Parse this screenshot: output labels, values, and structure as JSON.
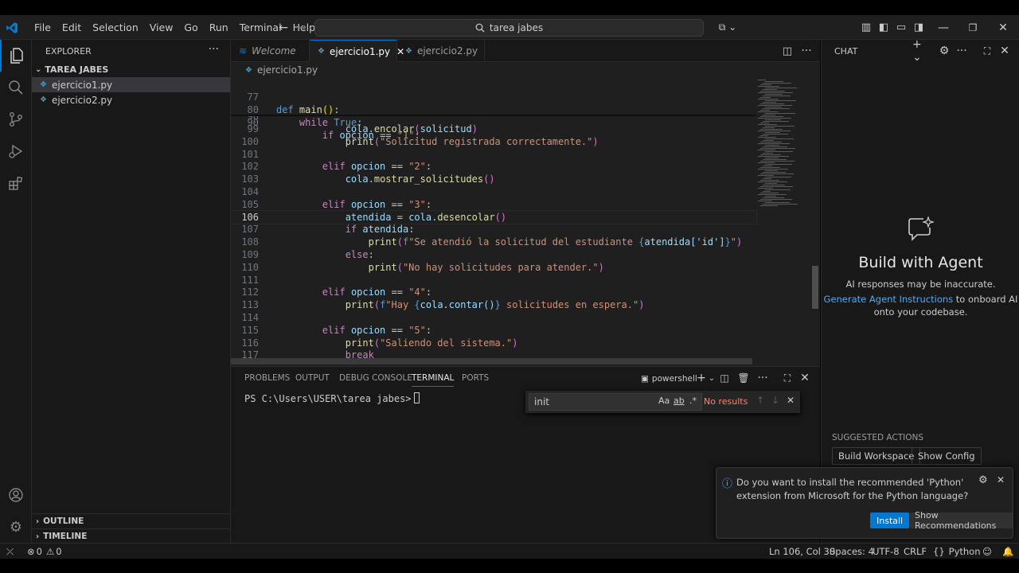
{
  "titlebar": {
    "menu": [
      "File",
      "Edit",
      "Selection",
      "View",
      "Go",
      "Run",
      "Terminal",
      "Help"
    ],
    "command_center": "tarea jabes",
    "icons": [
      "vscode-logo-icon",
      "back-arrow-icon",
      "forward-arrow-icon",
      "search-icon",
      "copilot-icon",
      "layout-icon",
      "minimize-icon",
      "restore-icon",
      "close-icon"
    ]
  },
  "activity_bar": [
    "files-icon",
    "search-icon",
    "source-control-icon",
    "run-debug-icon",
    "extensions-icon",
    "account-icon",
    "settings-gear-icon"
  ],
  "sidebar": {
    "title": "EXPLORER",
    "folder": "TAREA JABES",
    "files": [
      "ejercicio1.py",
      "ejercicio2.py"
    ],
    "selected_file": "ejercicio1.py",
    "outline": "OUTLINE",
    "timeline": "TIMELINE"
  },
  "tabs": [
    {
      "label": "Welcome",
      "active": false
    },
    {
      "label": "ejercicio1.py",
      "active": true
    },
    {
      "label": "ejercicio2.py",
      "active": false
    }
  ],
  "breadcrumb": "ejercicio1.py",
  "editor": {
    "sticky": [
      {
        "num": "77",
        "code": "def main():"
      },
      {
        "num": "80",
        "code": "    while True:"
      },
      {
        "num": "90",
        "code": "        if opcion == \"1\":"
      }
    ],
    "partial_line": "98",
    "lines": [
      {
        "num": "99",
        "code": "            cola.encolar(solicitud)"
      },
      {
        "num": "100",
        "code": "            print(\"Solicitud registrada correctamente.\")"
      },
      {
        "num": "101",
        "code": ""
      },
      {
        "num": "102",
        "code": "        elif opcion == \"2\":"
      },
      {
        "num": "103",
        "code": "            cola.mostrar_solicitudes()"
      },
      {
        "num": "104",
        "code": ""
      },
      {
        "num": "105",
        "code": "        elif opcion == \"3\":"
      },
      {
        "num": "106",
        "code": "            atendida = cola.desencolar()"
      },
      {
        "num": "107",
        "code": "            if atendida:"
      },
      {
        "num": "108",
        "code": "                print(f\"Se atendió la solicitud del estudiante {atendida['id']}\")"
      },
      {
        "num": "109",
        "code": "            else:"
      },
      {
        "num": "110",
        "code": "                print(\"No hay solicitudes para atender.\")"
      },
      {
        "num": "111",
        "code": ""
      },
      {
        "num": "112",
        "code": "        elif opcion == \"4\":"
      },
      {
        "num": "113",
        "code": "            print(f\"Hay {cola.contar()} solicitudes en espera.\")"
      },
      {
        "num": "114",
        "code": ""
      },
      {
        "num": "115",
        "code": "        elif opcion == \"5\":"
      },
      {
        "num": "116",
        "code": "            print(\"Saliendo del sistema.\")"
      },
      {
        "num": "117",
        "code": "            break"
      }
    ],
    "current_line": "106"
  },
  "panel": {
    "tabs": [
      "PROBLEMS",
      "OUTPUT",
      "DEBUG CONSOLE",
      "TERMINAL",
      "PORTS"
    ],
    "active_tab": "TERMINAL",
    "shell": "powershell",
    "prompt": "PS C:\\Users\\USER\\tarea jabes>",
    "find": {
      "value": "init",
      "result": "No results",
      "opt_case": "Aa",
      "opt_word": "ab",
      "opt_regex": ".*"
    }
  },
  "chat": {
    "title": "CHAT",
    "heading": "Build with Agent",
    "disclaimer": "AI responses may be inaccurate.",
    "link": "Generate Agent Instructions",
    "link_suffix": " to onboard AI",
    "line3": "onto your codebase.",
    "suggested_title": "SUGGESTED ACTIONS",
    "suggested": [
      "Build Workspace",
      "Show Config"
    ]
  },
  "notification": {
    "message": "Do you want to install the recommended 'Python' extension from Microsoft for the Python language?",
    "install": "Install",
    "show": "Show Recommendations"
  },
  "statusbar": {
    "errors": "0",
    "warnings": "0",
    "position": "Ln 106, Col 30",
    "spaces": "Spaces: 4",
    "encoding": "UTF-8",
    "eol": "CRLF",
    "language": "Python"
  },
  "colors": {
    "accent": "#0078d4",
    "link": "#4daafc",
    "editor_bg": "#1f1f1f",
    "side_bg": "#181818"
  }
}
